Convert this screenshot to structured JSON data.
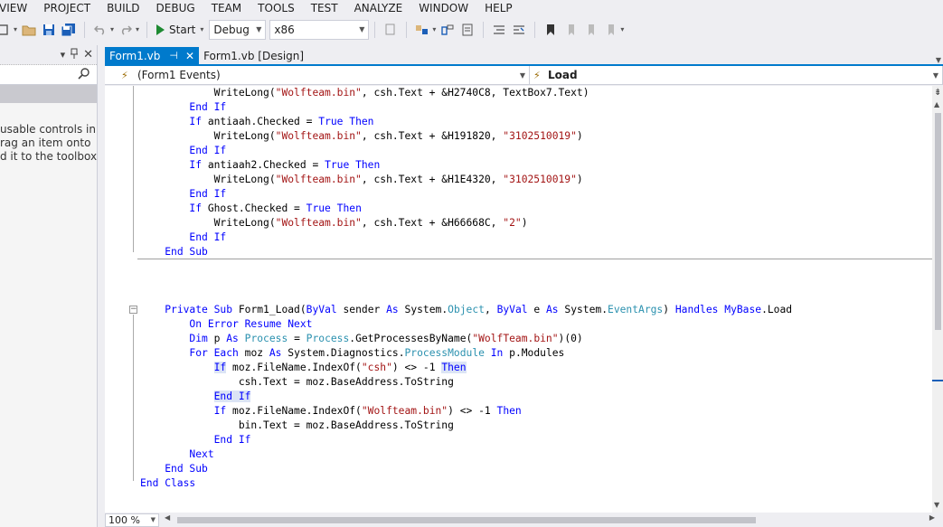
{
  "menu": [
    "VIEW",
    "PROJECT",
    "BUILD",
    "DEBUG",
    "TEAM",
    "TOOLS",
    "TEST",
    "ANALYZE",
    "WINDOW",
    "HELP"
  ],
  "toolbar": {
    "start_label": "Start",
    "config_value": "Debug",
    "platform_value": "x86"
  },
  "toolbox": {
    "message": [
      "usable controls in",
      "rag an item onto",
      "d it to the toolbox."
    ]
  },
  "tabs": [
    {
      "label": "Form1.vb",
      "active": true
    },
    {
      "label": "Form1.vb [Design]",
      "active": false
    }
  ],
  "navbar": {
    "left": "(Form1 Events)",
    "right": "Load"
  },
  "code_lines": [
    [
      [
        "p",
        "            WriteLong("
      ],
      [
        "s",
        "\"Wolfteam.bin\""
      ],
      [
        "p",
        ", csh.Text + &H2740C8, TextBox7.Text)"
      ]
    ],
    [
      [
        "p",
        "        "
      ],
      [
        "k",
        "End If"
      ]
    ],
    [
      [
        "p",
        "        "
      ],
      [
        "k",
        "If"
      ],
      [
        "p",
        " antiaah.Checked = "
      ],
      [
        "k",
        "True Then"
      ]
    ],
    [
      [
        "p",
        "            WriteLong("
      ],
      [
        "s",
        "\"Wolfteam.bin\""
      ],
      [
        "p",
        ", csh.Text + &H191820, "
      ],
      [
        "s",
        "\"3102510019\""
      ],
      [
        "p",
        ")"
      ]
    ],
    [
      [
        "p",
        "        "
      ],
      [
        "k",
        "End If"
      ]
    ],
    [
      [
        "p",
        "        "
      ],
      [
        "k",
        "If"
      ],
      [
        "p",
        " antiaah2.Checked = "
      ],
      [
        "k",
        "True Then"
      ]
    ],
    [
      [
        "p",
        "            WriteLong("
      ],
      [
        "s",
        "\"Wolfteam.bin\""
      ],
      [
        "p",
        ", csh.Text + &H1E4320, "
      ],
      [
        "s",
        "\"3102510019\""
      ],
      [
        "p",
        ")"
      ]
    ],
    [
      [
        "p",
        "        "
      ],
      [
        "k",
        "End If"
      ]
    ],
    [
      [
        "p",
        "        "
      ],
      [
        "k",
        "If"
      ],
      [
        "p",
        " Ghost.Checked = "
      ],
      [
        "k",
        "True Then"
      ]
    ],
    [
      [
        "p",
        "            WriteLong("
      ],
      [
        "s",
        "\"Wolfteam.bin\""
      ],
      [
        "p",
        ", csh.Text + &H66668C, "
      ],
      [
        "s",
        "\"2\""
      ],
      [
        "p",
        ")"
      ]
    ],
    [
      [
        "p",
        "        "
      ],
      [
        "k",
        "End If"
      ]
    ],
    [
      [
        "p",
        "    "
      ],
      [
        "k",
        "End Sub"
      ]
    ],
    [],
    [],
    [],
    [
      [
        "p",
        "    "
      ],
      [
        "k",
        "Private Sub"
      ],
      [
        "p",
        " Form1_Load("
      ],
      [
        "k",
        "ByVal"
      ],
      [
        "p",
        " sender "
      ],
      [
        "k",
        "As"
      ],
      [
        "p",
        " System."
      ],
      [
        "t",
        "Object"
      ],
      [
        "p",
        ", "
      ],
      [
        "k",
        "ByVal"
      ],
      [
        "p",
        " e "
      ],
      [
        "k",
        "As"
      ],
      [
        "p",
        " System."
      ],
      [
        "t",
        "EventArgs"
      ],
      [
        "p",
        ") "
      ],
      [
        "k",
        "Handles"
      ],
      [
        "p",
        " "
      ],
      [
        "k",
        "MyBase"
      ],
      [
        "p",
        ".Load"
      ]
    ],
    [
      [
        "p",
        "        "
      ],
      [
        "k",
        "On Error Resume Next"
      ]
    ],
    [
      [
        "p",
        "        "
      ],
      [
        "k",
        "Dim"
      ],
      [
        "p",
        " p "
      ],
      [
        "k",
        "As"
      ],
      [
        "p",
        " "
      ],
      [
        "t",
        "Process"
      ],
      [
        "p",
        " = "
      ],
      [
        "t",
        "Process"
      ],
      [
        "p",
        ".GetProcessesByName("
      ],
      [
        "s",
        "\"WolfTeam.bin\""
      ],
      [
        "p",
        ")(0)"
      ]
    ],
    [
      [
        "p",
        "        "
      ],
      [
        "k",
        "For Each"
      ],
      [
        "p",
        " moz "
      ],
      [
        "k",
        "As"
      ],
      [
        "p",
        " System.Diagnostics."
      ],
      [
        "t",
        "ProcessModule"
      ],
      [
        "p",
        " "
      ],
      [
        "k",
        "In"
      ],
      [
        "p",
        " p.Modules"
      ]
    ],
    [
      [
        "p",
        "            "
      ],
      [
        "kh",
        "If"
      ],
      [
        "p",
        " moz.FileName.IndexOf("
      ],
      [
        "s",
        "\"csh\""
      ],
      [
        "p",
        ") <> -1 "
      ],
      [
        "kh",
        "Then"
      ]
    ],
    [
      [
        "p",
        "                csh.Text = moz.BaseAddress.ToString"
      ]
    ],
    [
      [
        "p",
        "            "
      ],
      [
        "kh",
        "End If"
      ]
    ],
    [
      [
        "p",
        "            "
      ],
      [
        "k",
        "If"
      ],
      [
        "p",
        " moz.FileName.IndexOf("
      ],
      [
        "s",
        "\"Wolfteam.bin\""
      ],
      [
        "p",
        ") <> -1 "
      ],
      [
        "k",
        "Then"
      ]
    ],
    [
      [
        "p",
        "                bin.Text = moz.BaseAddress.ToString"
      ]
    ],
    [
      [
        "p",
        "            "
      ],
      [
        "k",
        "End If"
      ]
    ],
    [
      [
        "p",
        "        "
      ],
      [
        "k",
        "Next"
      ]
    ],
    [
      [
        "p",
        "    "
      ],
      [
        "k",
        "End Sub"
      ]
    ],
    [
      [
        "k",
        "End Class"
      ]
    ]
  ],
  "zoom": "100 %",
  "colors": {
    "keyword": "#0000ff",
    "string": "#a31515",
    "type": "#2b91af",
    "accent": "#007acc"
  }
}
